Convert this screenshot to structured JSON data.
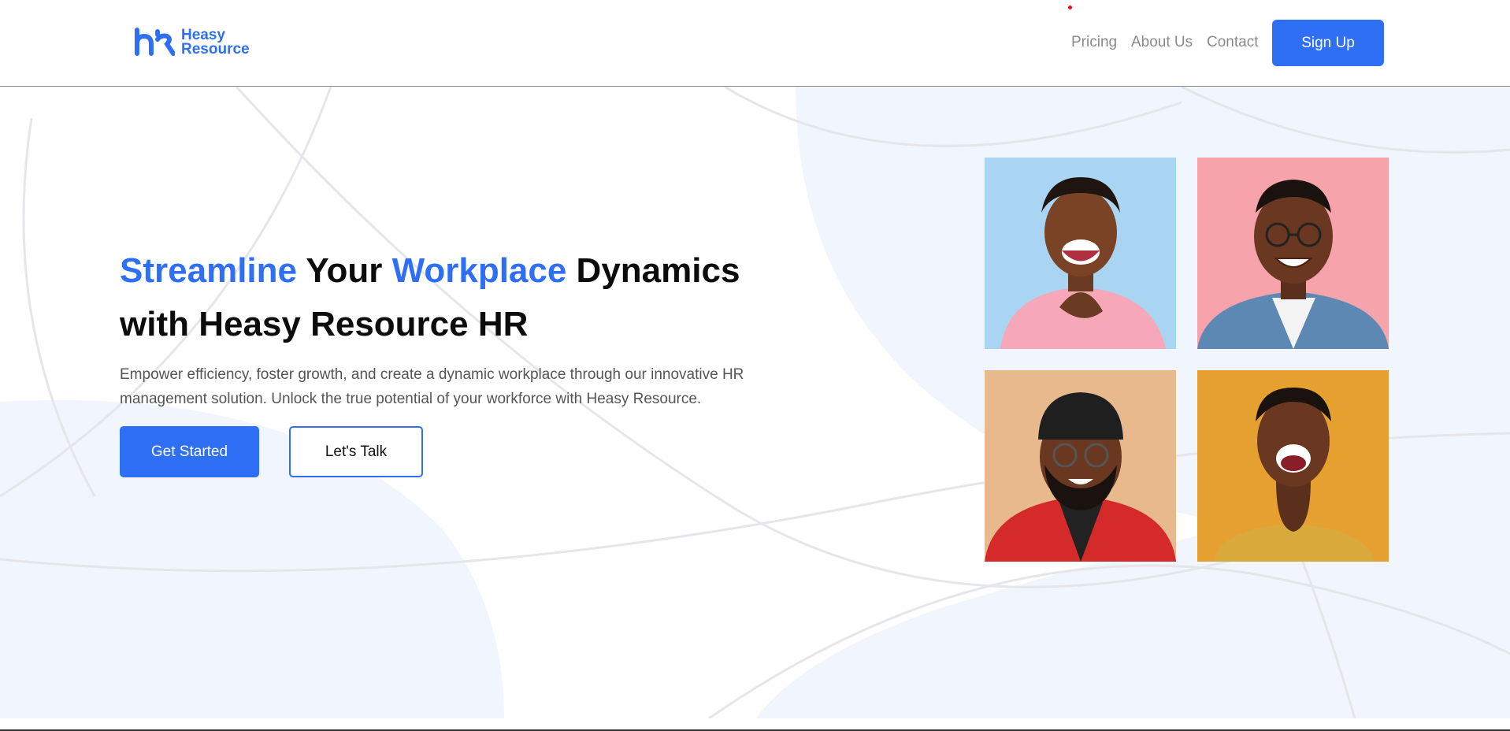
{
  "brand": {
    "name_line1": "Heasy",
    "name_line2": "Resource",
    "color": "#2f6ff5"
  },
  "nav": {
    "links": [
      "Pricing",
      "About Us",
      "Contact"
    ],
    "signup_label": "Sign Up"
  },
  "hero": {
    "headline_parts": [
      {
        "text": "Streamline",
        "accent": true
      },
      {
        "text": " Your ",
        "accent": false
      },
      {
        "text": "Workplace",
        "accent": true
      },
      {
        "text": " Dynamics with Heasy Resource HR",
        "accent": false
      }
    ],
    "description": "Empower efficiency, foster growth, and create a dynamic workplace through our innovative HR management solution. Unlock the true potential of your workforce with Heasy Resource.",
    "primary_button": "Get Started",
    "secondary_button": "Let's Talk"
  },
  "photos": [
    {
      "icon": "smiling-woman-photo",
      "background": "#a9d4f2",
      "shirt": "#f7a8b8"
    },
    {
      "icon": "smiling-man-glasses-photo",
      "background": "#f6a3ab",
      "shirt": "#5d88b3"
    },
    {
      "icon": "bearded-man-beanie-photo",
      "background": "#e8b98c",
      "shirt": "#d42a2a"
    },
    {
      "icon": "laughing-man-photo",
      "background": "#e6a030",
      "shirt": "#d9a93c"
    }
  ],
  "colors": {
    "accent": "#2f6ff5",
    "hero_tint": "#f1f5fd",
    "text_muted": "#555555",
    "nav_text": "#8a8a8a"
  }
}
